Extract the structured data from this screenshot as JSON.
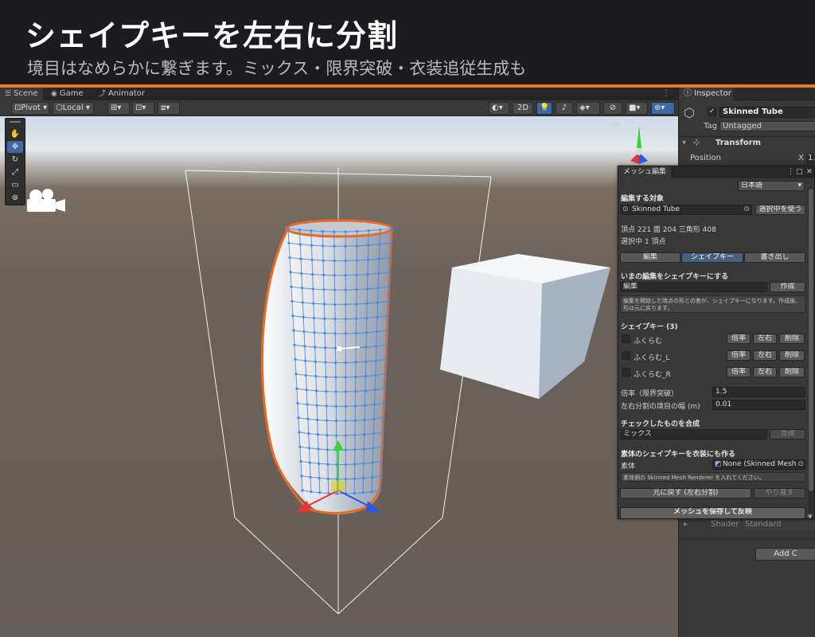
{
  "banner": {
    "title": "シェイプキーを左右に分割",
    "subtitle": "境目はなめらかに繋ぎます。ミックス・限界突破・衣装追従生成も"
  },
  "scene_tabs": [
    {
      "label": "Scene",
      "icon": "scene-icon"
    },
    {
      "label": "Game",
      "icon": "game-icon"
    },
    {
      "label": "Animator",
      "icon": "animator-icon"
    }
  ],
  "scene_toolbar": {
    "pivot": "Pivot",
    "local": "Local",
    "mode_2d": "2D"
  },
  "inspector": {
    "tab": "Inspector",
    "object_name": "Skinned Tube",
    "tag_label": "Tag",
    "tag_value": "Untagged",
    "transform": "Transform",
    "position_label": "Position",
    "position_x_label": "X",
    "position_x_value": "1.",
    "shader_label": "Shader",
    "shader_value": "Standard",
    "add_component": "Add C"
  },
  "panel": {
    "tab": "メッシュ編集",
    "language": "日本語",
    "target_header": "編集する対象",
    "target_value": "Skinned Tube",
    "use_selected": "選択中を使う",
    "stats": "頂点 221  面 204  三角形 408",
    "selected": "選択中 1 頂点",
    "tabs": [
      "編集",
      "シェイプキー",
      "書き出し"
    ],
    "active_tab": 1,
    "make_shapekey_header": "いまの編集をシェイプキーにする",
    "make_shapekey_name": "編集",
    "create_button": "作成",
    "make_shapekey_help": "編集を開始した時点の形との差が、シェイプキーになります。作成後、形は元に戻ります。",
    "shapekeys_header": "シェイプキー (3)",
    "shapekeys": [
      {
        "name": "ふくらむ"
      },
      {
        "name": "ふくらむ_L"
      },
      {
        "name": "ふくらむ_R"
      }
    ],
    "btn_scale": "倍率",
    "btn_lr": "左右",
    "btn_delete": "削除",
    "rate_label": "倍率（限界突破）",
    "rate_value": "1.5",
    "split_label": "左右分割の境目の幅 (m)",
    "split_value": "0.01",
    "combine_header": "チェックしたものを合成",
    "combine_name": "ミックス",
    "combine_button": "合成",
    "outfit_header": "素体のシェイプキーを衣装にも作る",
    "body_label": "素体",
    "body_value": "None (Skinned Mesh",
    "body_help": "素体側の Skinned Mesh Renderer を入れてください。",
    "revert_button": "元に戻す (左右分割)",
    "redo_button": "やり直す",
    "save_button": "メッシュを保存して反映"
  }
}
